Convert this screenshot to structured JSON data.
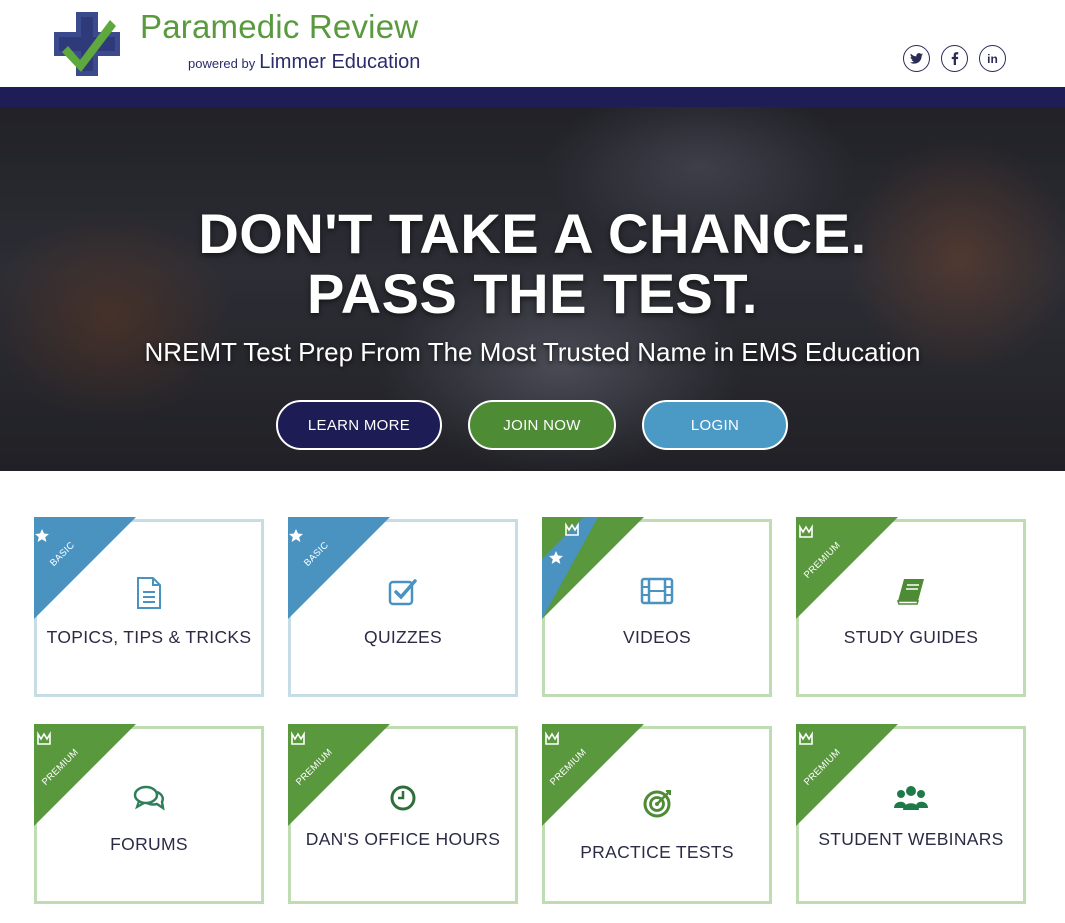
{
  "brand": {
    "title": "Paramedic Review",
    "powered_by": "powered by",
    "company": "Limmer Education"
  },
  "social": [
    {
      "name": "twitter",
      "glyph": "t"
    },
    {
      "name": "facebook",
      "glyph": "f"
    },
    {
      "name": "linkedin",
      "glyph": "in"
    }
  ],
  "hero": {
    "headline_1": "DON'T TAKE A CHANCE.",
    "headline_2": "PASS THE TEST.",
    "subheadline": "NREMT Test Prep From The Most Trusted Name in EMS Education",
    "buttons": {
      "learn_more": "LEARN MORE",
      "join_now": "JOIN NOW",
      "login": "LOGIN"
    }
  },
  "colors": {
    "navy": "#1f1d55",
    "green": "#5a9a3f",
    "blue": "#4b9ac5",
    "basic_ribbon": "#4a93c0",
    "premium_ribbon": "#5a983e"
  },
  "tiers": {
    "basic": "BASIC",
    "premium": "PREMIUM"
  },
  "cards": [
    {
      "label": "TOPICS, TIPS & TRICKS",
      "tier": "basic",
      "icon": "document-icon"
    },
    {
      "label": "QUIZZES",
      "tier": "basic",
      "icon": "checkbox-icon"
    },
    {
      "label": "VIDEOS",
      "tier": "mixed",
      "icon": "film-icon"
    },
    {
      "label": "STUDY GUIDES",
      "tier": "premium",
      "icon": "book-icon"
    },
    {
      "label": "FORUMS",
      "tier": "premium",
      "icon": "chat-icon"
    },
    {
      "label": "DAN'S OFFICE HOURS",
      "tier": "premium",
      "icon": "clock-icon"
    },
    {
      "label": "PRACTICE TESTS",
      "tier": "premium",
      "icon": "target-icon"
    },
    {
      "label": "STUDENT WEBINARS",
      "tier": "premium",
      "icon": "users-icon"
    }
  ]
}
